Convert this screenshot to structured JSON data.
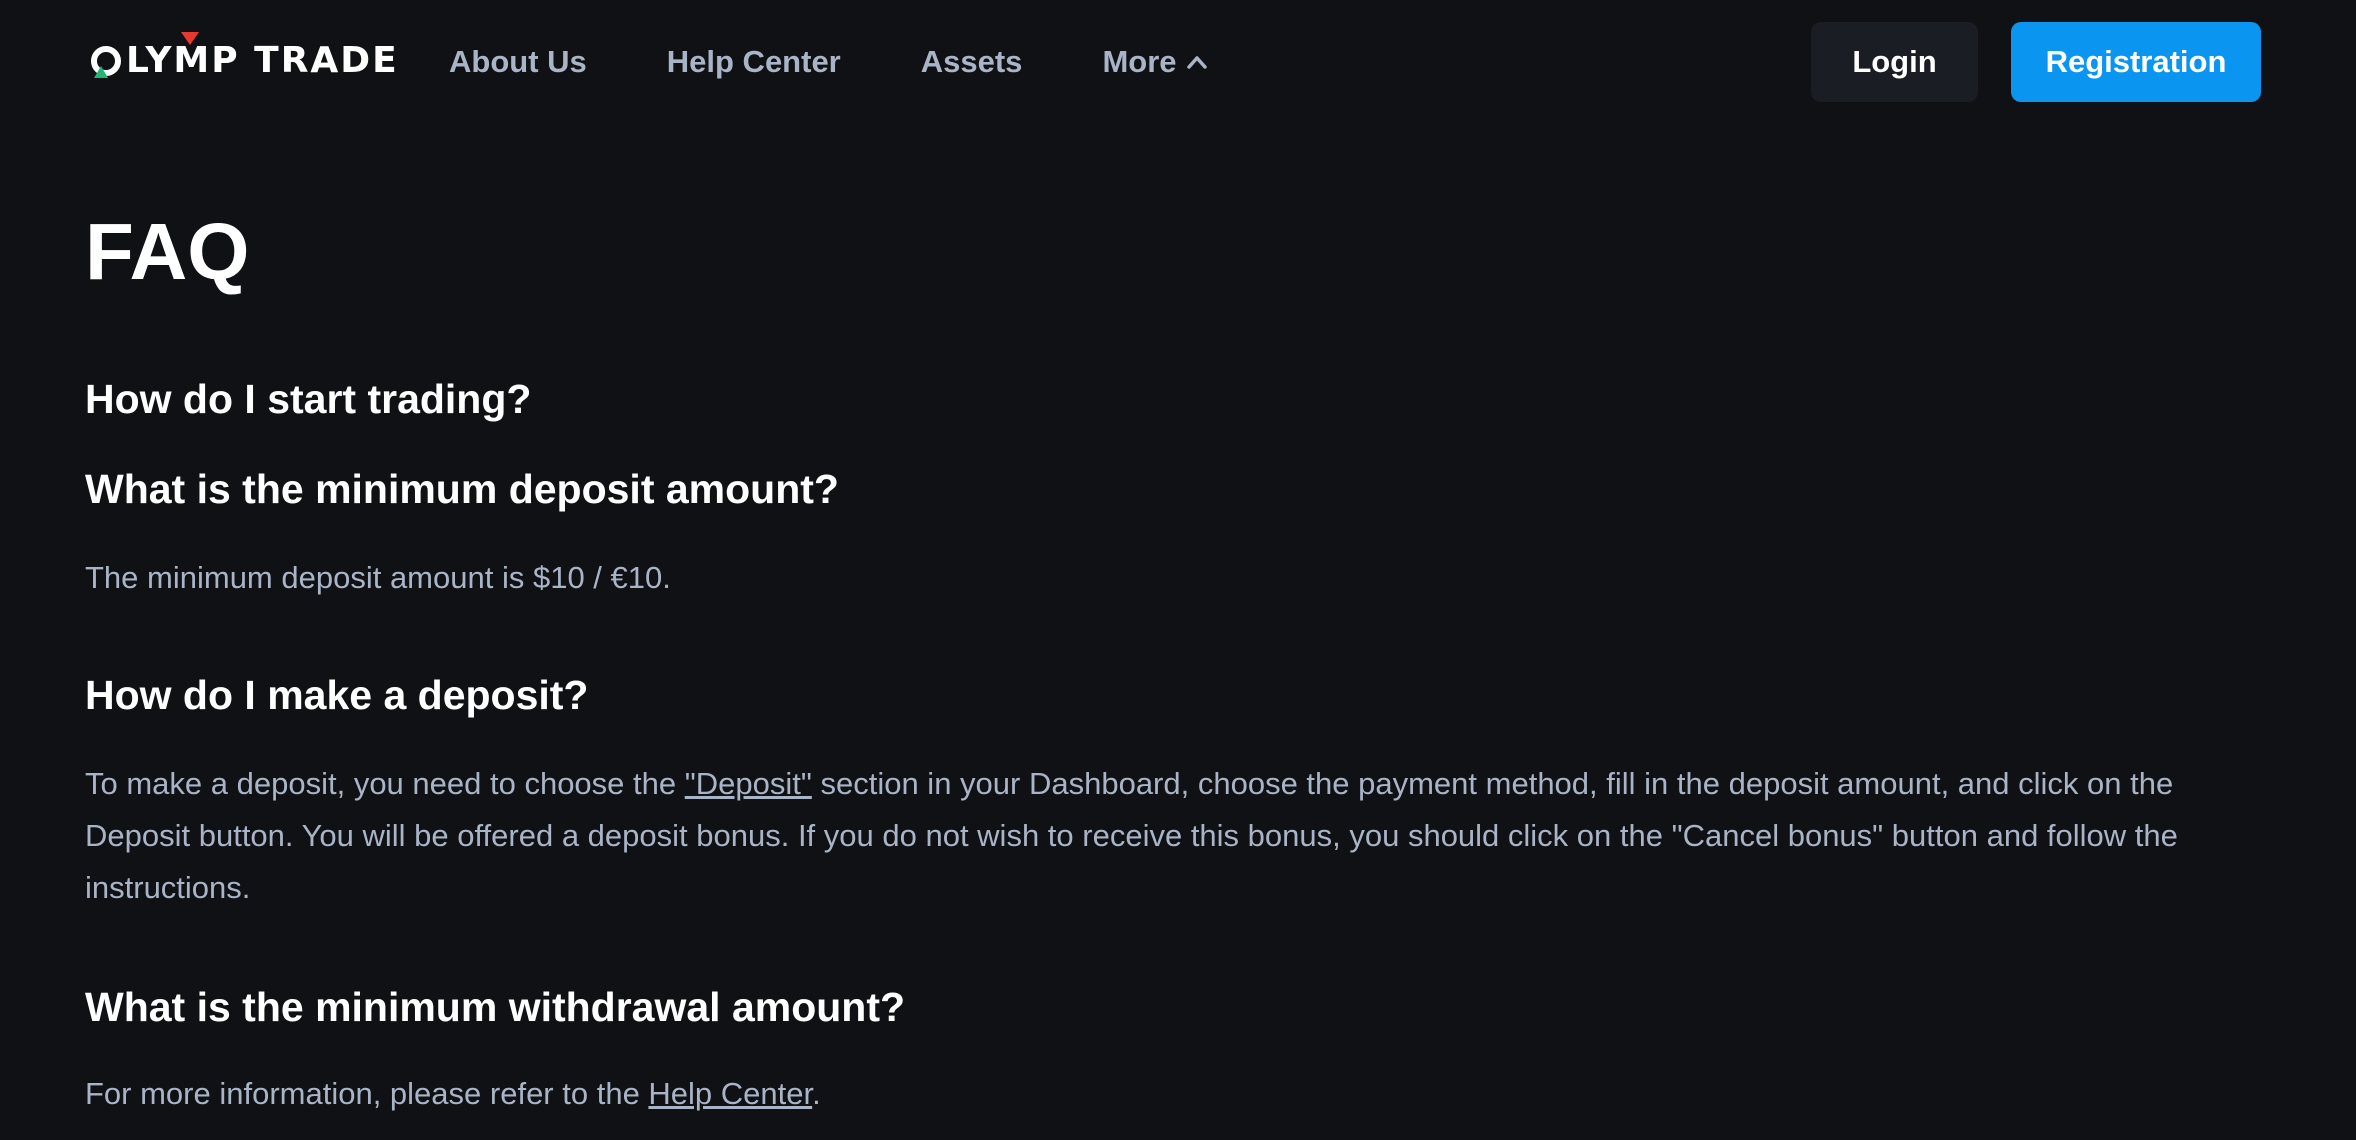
{
  "brand": {
    "logo_text": "OLYMP TRADE"
  },
  "nav": {
    "items": [
      "About Us",
      "Help Center",
      "Assets",
      "More"
    ]
  },
  "auth": {
    "login_label": "Login",
    "registration_label": "Registration"
  },
  "page": {
    "title": "FAQ"
  },
  "faq": [
    {
      "question": "How do I start trading?"
    },
    {
      "question": "What is the minimum deposit amount?",
      "answer": "The minimum deposit amount is $10 / €10."
    },
    {
      "question": "How do I make a deposit?",
      "answer_before": "To make a deposit, you need to choose the ",
      "answer_link": "\"Deposit\"",
      "answer_after": " section in your Dashboard, choose the payment method, fill in the deposit amount, and click on the Deposit button. You will be offered a deposit bonus. If you do not wish to receive this bonus, you should click on the \"Cancel bonus\" button and follow the instructions."
    },
    {
      "question": "What is the minimum withdrawal amount?",
      "answer_before": "For more information, please refer to the ",
      "answer_link": "Help Center",
      "answer_after": "."
    }
  ],
  "colors": {
    "background": "#0f1115",
    "accent": "#0a96f0",
    "muted_text": "#a9b4c6",
    "logo_red": "#e8392e",
    "logo_green": "#21b573"
  },
  "icons": [
    "chevron-up-icon",
    "olymp-logo-icon"
  ]
}
